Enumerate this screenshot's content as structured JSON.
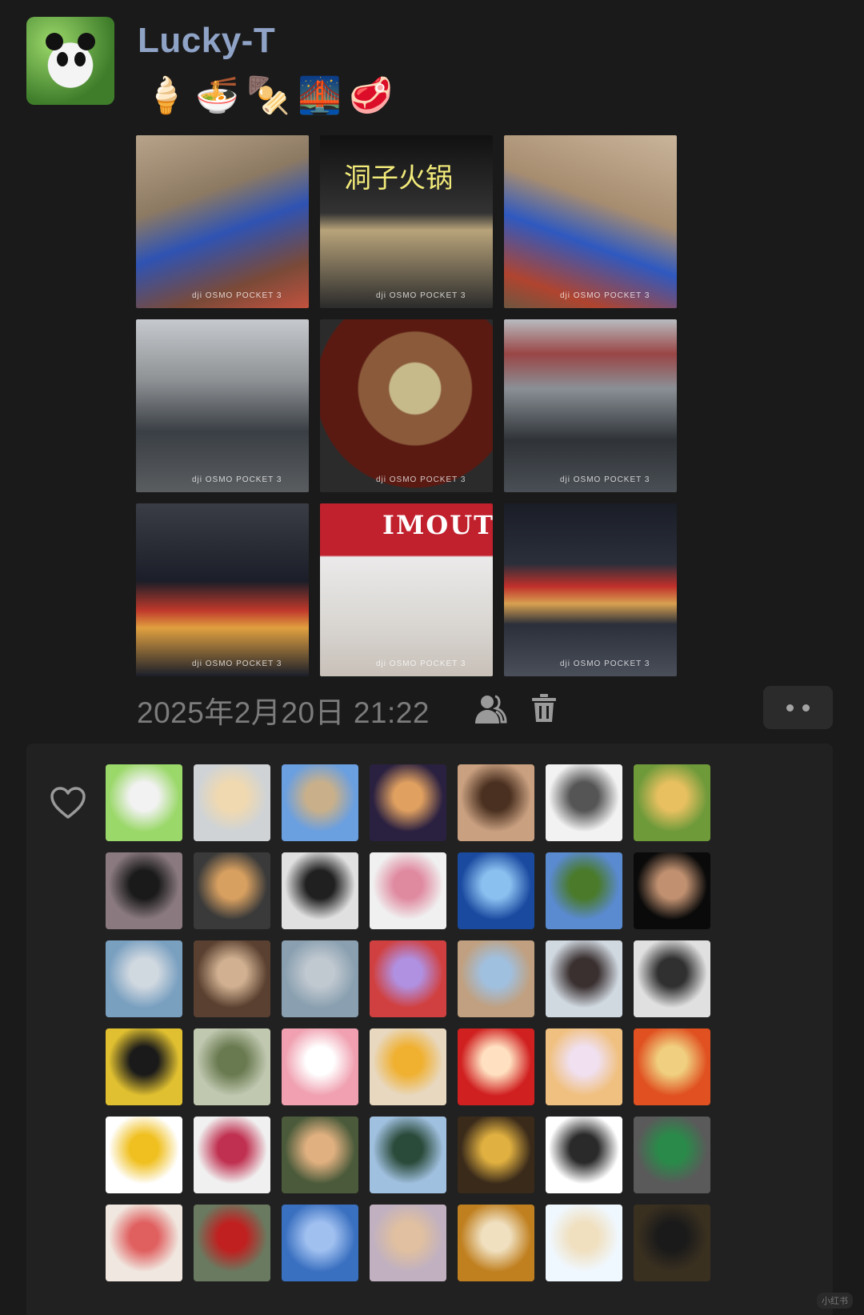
{
  "post": {
    "author": "Lucky-T",
    "emojis": [
      "🍦",
      "🍜",
      "🍢",
      "🌉",
      "🥩"
    ],
    "timestamp": "2025年2月20日  21:22",
    "photos": [
      {
        "name": "hotpot-table-woman",
        "watermark": "dji OSMO POCKET 3"
      },
      {
        "name": "hotpot-restaurant-entrance",
        "watermark": "dji OSMO POCKET 3",
        "sign_text": "洞子火锅"
      },
      {
        "name": "hotpot-table-woman-eating",
        "watermark": "dji OSMO POCKET 3"
      },
      {
        "name": "couple-selfie-building",
        "watermark": "dji OSMO POCKET 3"
      },
      {
        "name": "hotpot-pot",
        "watermark": "dji OSMO POCKET 3"
      },
      {
        "name": "couple-selfie-monorail",
        "watermark": "dji OSMO POCKET 3"
      },
      {
        "name": "night-bridge-skyline",
        "watermark": "dji OSMO POCKET 3"
      },
      {
        "name": "moutai-store-cup",
        "watermark": "dji OSMO POCKET 3",
        "sign_text": "IMOUTA"
      },
      {
        "name": "night-riverside-woman",
        "watermark": "dji OSMO POCKET 3"
      }
    ]
  },
  "actions": {
    "visibility_icon": "friends-icon",
    "delete_icon": "trash-icon",
    "more_icon": "more-icon"
  },
  "likes": {
    "icon": "heart-icon",
    "avatars": [
      {
        "name": "panda",
        "c1": "#9bd86a",
        "c2": "#f2f2f2"
      },
      {
        "name": "cat-drink",
        "c1": "#cfd3d6",
        "c2": "#f0d9b0"
      },
      {
        "name": "woman-sky",
        "c1": "#6a9fe0",
        "c2": "#c9b08a"
      },
      {
        "name": "city-night",
        "c1": "#2a2040",
        "c2": "#e0a060"
      },
      {
        "name": "woman-portrait",
        "c1": "#c9a080",
        "c2": "#4a3020"
      },
      {
        "name": "sketch-girl",
        "c1": "#f2f2f2",
        "c2": "#555555"
      },
      {
        "name": "woman-garden",
        "c1": "#6f9a3a",
        "c2": "#e8c060"
      },
      {
        "name": "man-night",
        "c1": "#8a7a80",
        "c2": "#1a1a1a"
      },
      {
        "name": "shiba-dog",
        "c1": "#3a3a3a",
        "c2": "#d8a060"
      },
      {
        "name": "girl-peace",
        "c1": "#e0e0e0",
        "c2": "#202020"
      },
      {
        "name": "cartoon-girl-car",
        "c1": "#f0f0f0",
        "c2": "#e08aa0"
      },
      {
        "name": "diver",
        "c1": "#1a4aa0",
        "c2": "#8ac0f0"
      },
      {
        "name": "field-figure",
        "c1": "#5a8ad0",
        "c2": "#4a7a2a"
      },
      {
        "name": "dark-portrait",
        "c1": "#0a0a0a",
        "c2": "#c09070"
      },
      {
        "name": "river-woman",
        "c1": "#7aa0c0",
        "c2": "#d0d8e0"
      },
      {
        "name": "statue-woman",
        "c1": "#5a4030",
        "c2": "#d0b090"
      },
      {
        "name": "street-walker",
        "c1": "#8aa0b0",
        "c2": "#c0c8d0"
      },
      {
        "name": "cartoon-christmas",
        "c1": "#d04040",
        "c2": "#b090e0"
      },
      {
        "name": "woman-dress",
        "c1": "#c0a080",
        "c2": "#a0c0e0"
      },
      {
        "name": "girl-window",
        "c1": "#d0d8e0",
        "c2": "#3a3030"
      },
      {
        "name": "bw-street",
        "c1": "#e0e0e0",
        "c2": "#303030"
      },
      {
        "name": "sunglasses-yellow",
        "c1": "#e0c030",
        "c2": "#1a1a1a"
      },
      {
        "name": "family-photo",
        "c1": "#c0c8b0",
        "c2": "#6a7a50"
      },
      {
        "name": "cartoon-couple",
        "c1": "#f0a0b0",
        "c2": "#ffffff"
      },
      {
        "name": "sunflower-girl",
        "c1": "#e8d8c0",
        "c2": "#f0b030"
      },
      {
        "name": "cartoon-new-year",
        "c1": "#d02020",
        "c2": "#ffe0c0"
      },
      {
        "name": "anime-girl",
        "c1": "#f0c080",
        "c2": "#f0e0f0"
      },
      {
        "name": "wan-shi-ru-yi",
        "c1": "#e05020",
        "c2": "#f0d080"
      },
      {
        "name": "cartoon-cat-crown",
        "c1": "#ffffff",
        "c2": "#f0c020"
      },
      {
        "name": "bonsai",
        "c1": "#f0f0f0",
        "c2": "#c03050"
      },
      {
        "name": "blonde-woman",
        "c1": "#4a5a3a",
        "c2": "#e0b080"
      },
      {
        "name": "skier",
        "c1": "#a0c0e0",
        "c2": "#2a4a3a"
      },
      {
        "name": "temple-night",
        "c1": "#3a2a1a",
        "c2": "#e0b040"
      },
      {
        "name": "cartoon-cat-girl",
        "c1": "#ffffff",
        "c2": "#2a2a2a"
      },
      {
        "name": "cat-green-scarf",
        "c1": "#5a5a5a",
        "c2": "#2a8a4a"
      },
      {
        "name": "red-bottle-poster",
        "c1": "#f0e8e0",
        "c2": "#e06060"
      },
      {
        "name": "girl-fu-card",
        "c1": "#6a7a60",
        "c2": "#c02020"
      },
      {
        "name": "sea-woman",
        "c1": "#3a70c0",
        "c2": "#a0c0f0"
      },
      {
        "name": "sunset-table",
        "c1": "#c0b0c0",
        "c2": "#e0c0a0"
      },
      {
        "name": "lion-dance-toy",
        "c1": "#c08020",
        "c2": "#f0e0c0"
      },
      {
        "name": "cute-bear",
        "c1": "#f0f8ff",
        "c2": "#f0e0c0"
      },
      {
        "name": "night-street-figure",
        "c1": "#3a3020",
        "c2": "#1a1a1a"
      }
    ]
  },
  "corner_tag": "小红书"
}
